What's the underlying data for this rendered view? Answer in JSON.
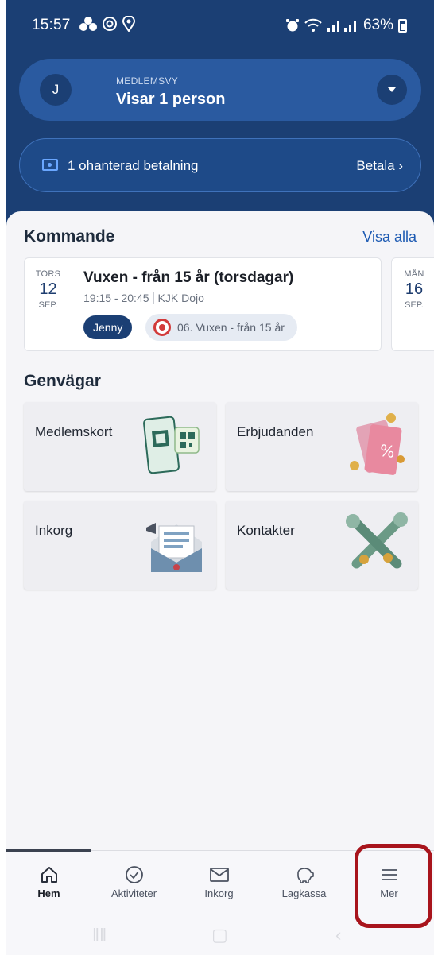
{
  "status_bar": {
    "time": "15:57",
    "battery": "63%"
  },
  "member": {
    "avatar_initial": "J",
    "label": "MEDLEMSVY",
    "title": "Visar 1 person"
  },
  "payment": {
    "text": "1 ohanterad betalning",
    "action": "Betala"
  },
  "upcoming": {
    "title": "Kommande",
    "see_all": "Visa alla",
    "events": [
      {
        "dow": "TORS",
        "day": "12",
        "month": "SEP.",
        "title": "Vuxen - från 15 år (torsdagar)",
        "time": "19:15 - 20:45",
        "place": "KJK Dojo",
        "person": "Jenny",
        "group": "06. Vuxen - från 15 år"
      },
      {
        "dow": "MÅN",
        "day": "16",
        "month": "SEP."
      }
    ]
  },
  "shortcuts": {
    "title": "Genvägar",
    "items": [
      "Medlemskort",
      "Erbjudanden",
      "Inkorg",
      "Kontakter"
    ]
  },
  "bottom_nav": {
    "items": [
      "Hem",
      "Aktiviteter",
      "Inkorg",
      "Lagkassa",
      "Mer"
    ],
    "active": "Hem"
  },
  "colors": {
    "header": "#1b3f74",
    "accent": "#1e5bb3",
    "highlight": "#a8141c"
  }
}
